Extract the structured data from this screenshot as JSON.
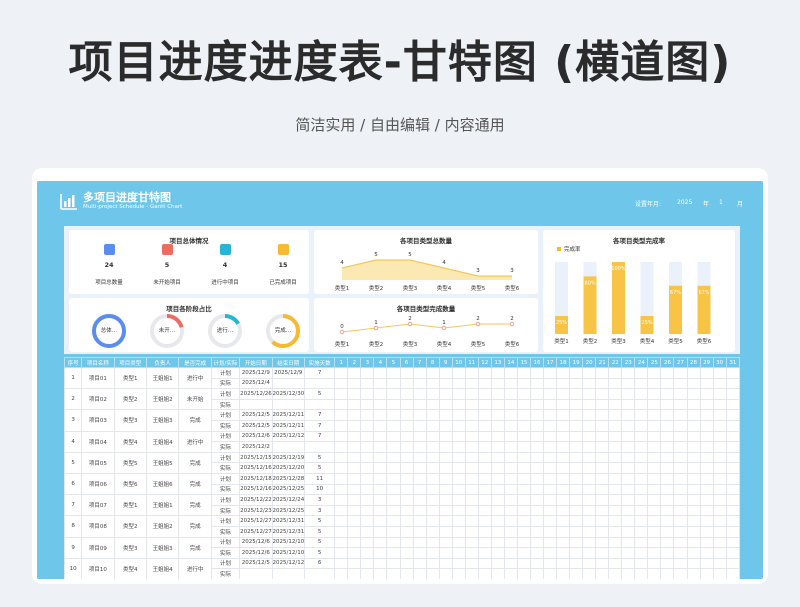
{
  "hero": {
    "title": "项目进度进度表-甘特图 (横道图)",
    "subtitle": "简洁实用 / 自由编辑 / 内容通用"
  },
  "sheet": {
    "title": "多项目进度甘特图",
    "subtitle": "Multi-project Schedule - Gantt Chart",
    "month_label": "设置年月:",
    "year": "2025",
    "year_unit": "年",
    "month": "1",
    "month_unit": "月"
  },
  "overview": {
    "title": "项目总体情况",
    "kpis": [
      {
        "icon": "folder-icon",
        "color": "#5b8def",
        "value": "24",
        "label": "项目总数量"
      },
      {
        "icon": "pause-icon",
        "color": "#f06b5f",
        "value": "5",
        "label": "未开始项目"
      },
      {
        "icon": "progress-icon",
        "color": "#26b5d6",
        "value": "4",
        "label": "进行中项目"
      },
      {
        "icon": "check-icon",
        "color": "#f5b932",
        "value": "15",
        "label": "已完成项目"
      }
    ]
  },
  "stages": {
    "title": "项目各阶段占比",
    "rings": [
      {
        "label": "总体…",
        "pct": 1.0,
        "color": "#5b8def"
      },
      {
        "label": "未开…",
        "pct": 0.21,
        "color": "#f06b5f"
      },
      {
        "label": "进行…",
        "pct": 0.17,
        "color": "#26b5d6"
      },
      {
        "label": "完成…",
        "pct": 0.62,
        "color": "#f5b932"
      }
    ]
  },
  "type_total": {
    "title": "各项目类型总数量",
    "chart_data": {
      "type": "area",
      "categories": [
        "类型1",
        "类型2",
        "类型3",
        "类型4",
        "类型5",
        "类型6"
      ],
      "values": [
        4,
        5,
        5,
        4,
        3,
        3
      ]
    }
  },
  "type_done": {
    "title": "各项目类型完成数量",
    "chart_data": {
      "type": "line",
      "categories": [
        "类型1",
        "类型2",
        "类型3",
        "类型4",
        "类型5",
        "类型6"
      ],
      "values": [
        0,
        1,
        2,
        1,
        2,
        2
      ]
    }
  },
  "type_rate": {
    "title": "各项目类型完成率",
    "legend": "完成率",
    "chart_data": {
      "type": "bar",
      "categories": [
        "类型1",
        "类型2",
        "类型3",
        "类型4",
        "类型5",
        "类型6"
      ],
      "values": [
        25,
        80,
        100,
        25,
        67,
        67
      ],
      "labels": [
        "25%",
        "80%",
        "100%",
        "25%",
        "67%",
        "67%"
      ],
      "ylim": [
        0,
        100
      ]
    }
  },
  "table": {
    "headers": [
      "序号",
      "项目名称",
      "项目类型",
      "负责人",
      "是否完成",
      "计划/实际",
      "开始日期",
      "结束日期",
      "实施天数"
    ],
    "days": [
      "1",
      "2",
      "3",
      "4",
      "5",
      "6",
      "7",
      "8",
      "9",
      "10",
      "11",
      "12",
      "13",
      "14",
      "15",
      "16",
      "17",
      "18",
      "19",
      "20",
      "21",
      "22",
      "23",
      "24",
      "25",
      "26",
      "27",
      "28",
      "29",
      "30",
      "31"
    ],
    "projects": [
      {
        "no": "1",
        "name": "项目01",
        "type": "类型1",
        "owner": "王姐姐1",
        "status": "进行中",
        "rows": [
          [
            "计划",
            "2025/12/9",
            "2025/12/9",
            "7"
          ],
          [
            "实际",
            "2025/12/4",
            "",
            ""
          ]
        ]
      },
      {
        "no": "2",
        "name": "项目02",
        "type": "类型2",
        "owner": "王姐姐2",
        "status": "未开始",
        "rows": [
          [
            "计划",
            "2025/12/26",
            "2025/12/30",
            "5"
          ],
          [
            "实际",
            "",
            "",
            ""
          ]
        ]
      },
      {
        "no": "3",
        "name": "项目03",
        "type": "类型3",
        "owner": "王姐姐3",
        "status": "完成",
        "rows": [
          [
            "计划",
            "2025/12/5",
            "2025/12/11",
            "7"
          ],
          [
            "实际",
            "2025/12/5",
            "2025/12/11",
            "7"
          ]
        ]
      },
      {
        "no": "4",
        "name": "项目04",
        "type": "类型4",
        "owner": "王姐姐4",
        "status": "进行中",
        "rows": [
          [
            "计划",
            "2025/12/6",
            "2025/12/12",
            "7"
          ],
          [
            "实际",
            "2025/12/2",
            "",
            ""
          ]
        ]
      },
      {
        "no": "5",
        "name": "项目05",
        "type": "类型5",
        "owner": "王姐姐5",
        "status": "完成",
        "rows": [
          [
            "计划",
            "2025/12/15",
            "2025/12/19",
            "5"
          ],
          [
            "实际",
            "2025/12/16",
            "2025/12/20",
            "5"
          ]
        ]
      },
      {
        "no": "6",
        "name": "项目06",
        "type": "类型6",
        "owner": "王姐姐6",
        "status": "完成",
        "rows": [
          [
            "计划",
            "2025/12/18",
            "2025/12/28",
            "11"
          ],
          [
            "实际",
            "2025/12/16",
            "2025/12/25",
            "10"
          ]
        ]
      },
      {
        "no": "7",
        "name": "项目07",
        "type": "类型1",
        "owner": "王姐姐1",
        "status": "完成",
        "rows": [
          [
            "计划",
            "2025/12/22",
            "2025/12/24",
            "3"
          ],
          [
            "实际",
            "2025/12/23",
            "2025/12/25",
            "3"
          ]
        ]
      },
      {
        "no": "8",
        "name": "项目08",
        "type": "类型2",
        "owner": "王姐姐2",
        "status": "完成",
        "rows": [
          [
            "计划",
            "2025/12/27",
            "2025/12/31",
            "5"
          ],
          [
            "实际",
            "2025/12/27",
            "2025/12/31",
            "5"
          ]
        ]
      },
      {
        "no": "9",
        "name": "项目09",
        "type": "类型3",
        "owner": "王姐姐3",
        "status": "完成",
        "rows": [
          [
            "计划",
            "2025/12/6",
            "2025/12/10",
            "5"
          ],
          [
            "实际",
            "2025/12/6",
            "2025/12/10",
            "5"
          ]
        ]
      },
      {
        "no": "10",
        "name": "项目10",
        "type": "类型4",
        "owner": "王姐姐4",
        "status": "进行中",
        "rows": [
          [
            "计划",
            "2025/12/5",
            "2025/12/12",
            "6"
          ],
          [
            "实际",
            "",
            "",
            ""
          ]
        ]
      }
    ]
  }
}
